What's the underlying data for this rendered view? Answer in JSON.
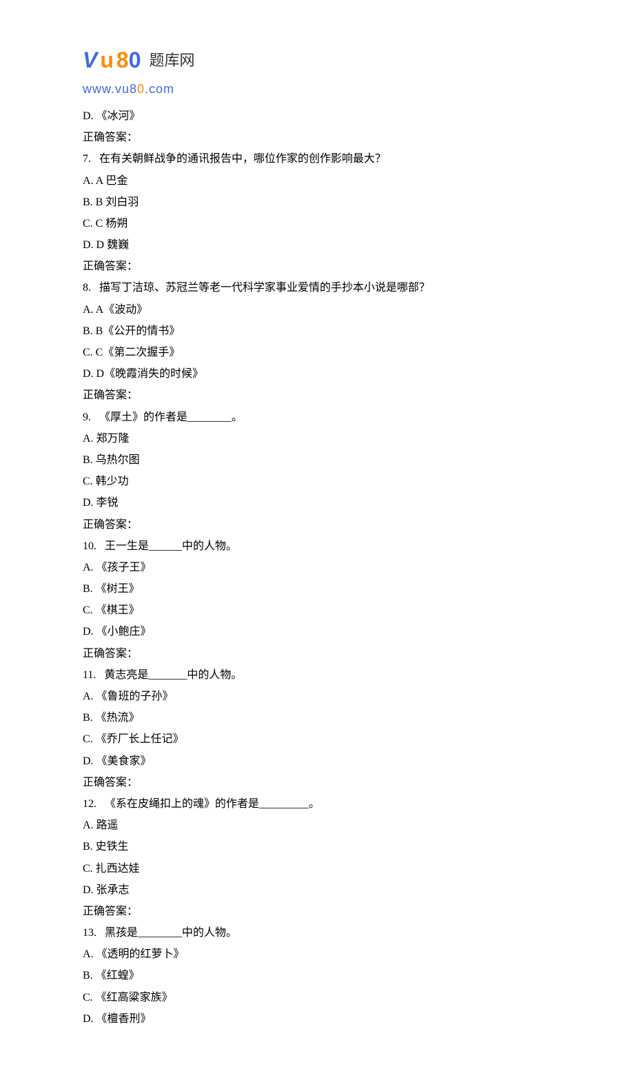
{
  "logo": {
    "brand_v": "V",
    "brand_u": "u",
    "brand_8": "8",
    "brand_0": "0",
    "brand_text": "题库网",
    "url_prefix": "www.vu8",
    "url_o": "0",
    "url_suffix": ".com"
  },
  "lead_option": "D.   《冰河》",
  "lead_answer_label": "正确答案：",
  "questions": [
    {
      "num": "7.",
      "text": "在有关朝鲜战争的通讯报告中，哪位作家的创作影响最大？",
      "options": [
        "A. A 巴金",
        "B. B 刘白羽",
        "C. C 杨朔",
        "D. D 魏巍"
      ],
      "answer_label": "正确答案："
    },
    {
      "num": "8.",
      "text": "描写丁洁琼、苏冠兰等老一代科学家事业爱情的手抄本小说是哪部？",
      "options": [
        "A. A《波动》",
        "B. B《公开的情书》",
        "C. C《第二次握手》",
        "D. D《晚霞消失的时候》"
      ],
      "answer_label": "正确答案："
    },
    {
      "num": "9.",
      "text": "《厚土》的作者是________。",
      "options": [
        "A.   郑万隆",
        "B.   乌热尔图",
        "C.   韩少功",
        "D.   李锐"
      ],
      "answer_label": "正确答案："
    },
    {
      "num": "10.",
      "text": "王一生是______中的人物。",
      "options": [
        "A.   《孩子王》",
        "B.   《树王》",
        "C.   《棋王》",
        "D.   《小鲍庄》"
      ],
      "answer_label": "正确答案："
    },
    {
      "num": "11.",
      "text": "黄志亮是_______中的人物。",
      "options": [
        "A.   《鲁班的子孙》",
        "B.   《热流》",
        "C.   《乔厂长上任记》",
        "D.   《美食家》"
      ],
      "answer_label": "正确答案："
    },
    {
      "num": "12.",
      "text": "《系在皮绳扣上的魂》的作者是_________。",
      "options": [
        "A.   路遥",
        "B.   史铁生",
        "C.   扎西达娃",
        "D.   张承志"
      ],
      "answer_label": "正确答案："
    },
    {
      "num": "13.",
      "text": "黑孩是________中的人物。",
      "options": [
        "A.   《透明的红萝卜》",
        "B.   《红蝗》",
        "C.   《红高粱家族》",
        "D.   《檀香刑》"
      ],
      "answer_label": ""
    }
  ]
}
